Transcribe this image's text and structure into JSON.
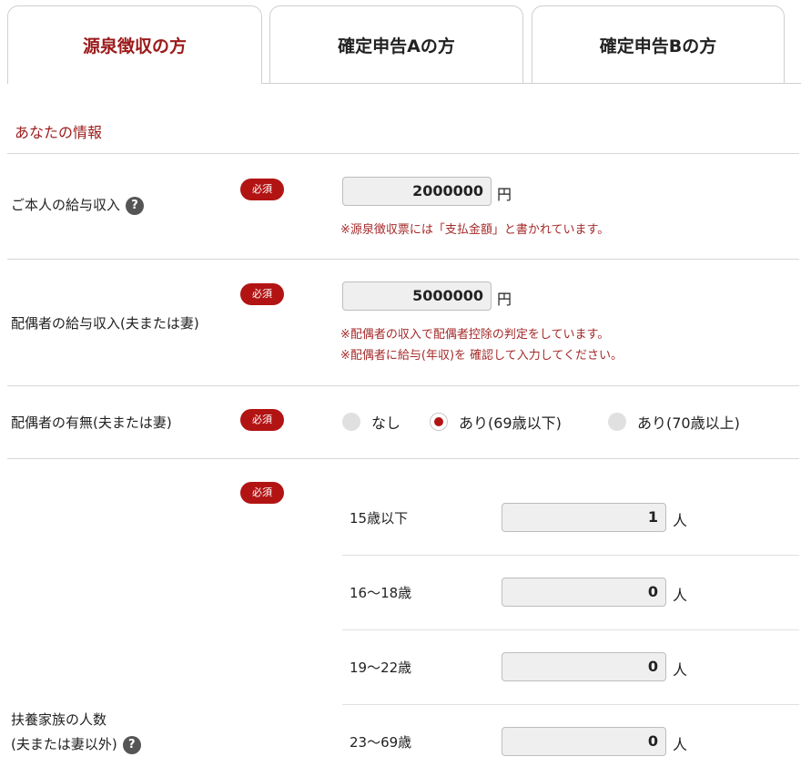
{
  "tabs": [
    "源泉徴収の方",
    "確定申告Aの方",
    "確定申告Bの方"
  ],
  "section_title": "あなたの情報",
  "required_badge": "必須",
  "help_glyph": "?",
  "salary": {
    "label": "ご本人の給与収入",
    "value": "2000000",
    "unit": "円",
    "note": "※源泉徴収票には「支払金額」と書かれています。"
  },
  "spouse_salary": {
    "label": "配偶者の給与収入(夫または妻)",
    "value": "5000000",
    "unit": "円",
    "notes": [
      "※配偶者の収入で配偶者控除の判定をしています。",
      "※配偶者に給与(年収)を 確認して入力してください。"
    ]
  },
  "spouse_presence": {
    "label": "配偶者の有無(夫または妻)",
    "options": [
      "なし",
      "あり(69歳以下)",
      "あり(70歳以上)"
    ],
    "selected": "あり(69歳以下)"
  },
  "dependents": {
    "label_line1": "扶養家族の人数",
    "label_line2": "(夫または妻以外)",
    "unit": "人",
    "rows": [
      {
        "label": "15歳以下",
        "value": "1"
      },
      {
        "label": "16～18歳",
        "value": "0"
      },
      {
        "label": "19～22歳",
        "value": "0"
      },
      {
        "label": "23～69歳",
        "value": "0"
      }
    ]
  },
  "colors": {
    "accent": "#9c1a1a",
    "badge": "#b21414",
    "note": "#a52a2a"
  }
}
